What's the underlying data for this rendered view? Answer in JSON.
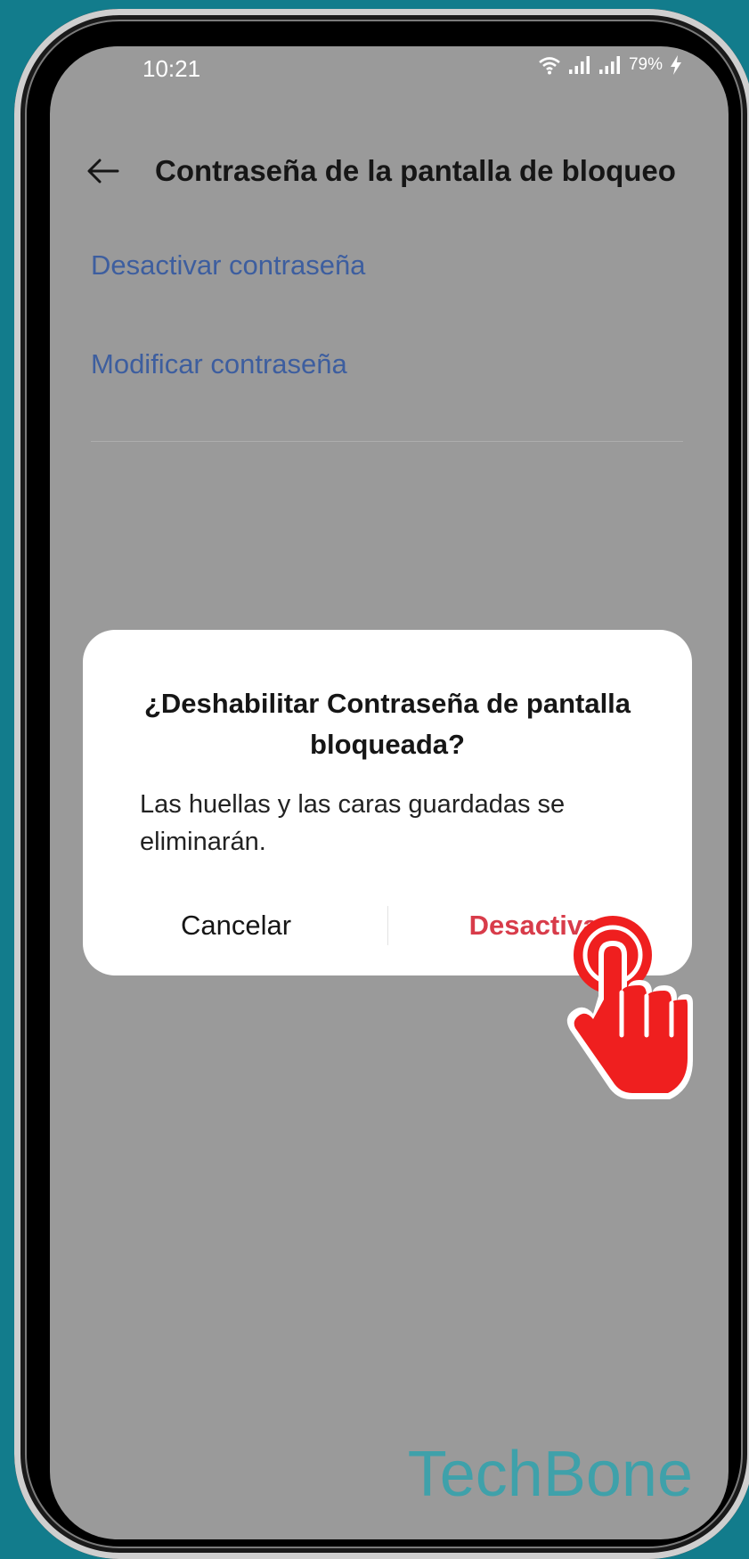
{
  "status_bar": {
    "time": "10:21",
    "battery": "79%",
    "icons": [
      "wifi-icon",
      "signal-icon",
      "signal-icon",
      "charging-icon"
    ]
  },
  "header": {
    "title": "Contraseña de la pantalla de bloqueo",
    "back_icon": "back-arrow-icon"
  },
  "options": {
    "disable_password": "Desactivar contraseña",
    "modify_password": "Modificar contraseña"
  },
  "dialog": {
    "title": "¿Deshabilitar Contraseña de pantalla bloqueada?",
    "message": "Las huellas y las caras guardadas se eliminarán.",
    "cancel_label": "Cancelar",
    "confirm_label": "Desactivar"
  },
  "overlay": {
    "tap_indicator_icon": "tap-hand-icon",
    "watermark": "TechBone"
  },
  "colors": {
    "background": "#127c8c",
    "screen_dim": "#9a9a9a",
    "link_blue": "#3d5e9f",
    "confirm_red": "#d83c4a",
    "tap_red": "#ef1f1f",
    "watermark": "#3fa1aa"
  }
}
